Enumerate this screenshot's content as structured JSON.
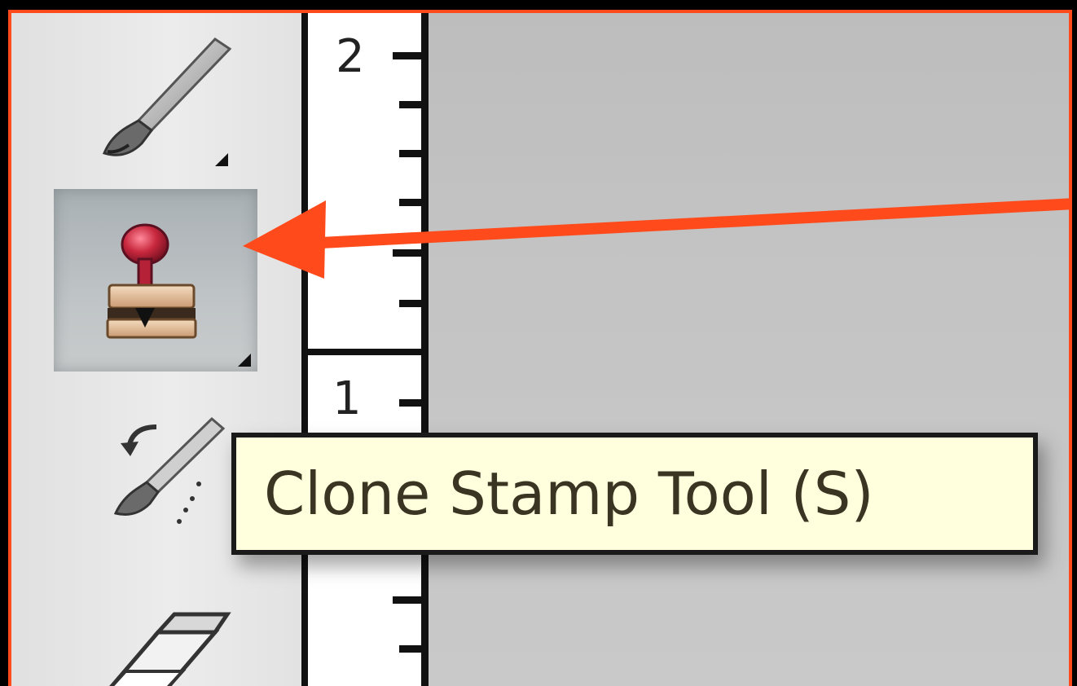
{
  "tooltip": {
    "text": "Clone Stamp Tool (S)"
  },
  "ruler": {
    "labels": [
      "2",
      "1"
    ]
  },
  "tools": {
    "brush": {
      "icon": "brush-icon"
    },
    "clone_stamp": {
      "icon": "clone-stamp-icon",
      "selected": true
    },
    "history_brush": {
      "icon": "history-brush-icon"
    },
    "eraser": {
      "icon": "eraser-icon"
    }
  },
  "annotation": {
    "arrow_color": "#ff4a1c",
    "frame_color": "#ff4a1c"
  }
}
